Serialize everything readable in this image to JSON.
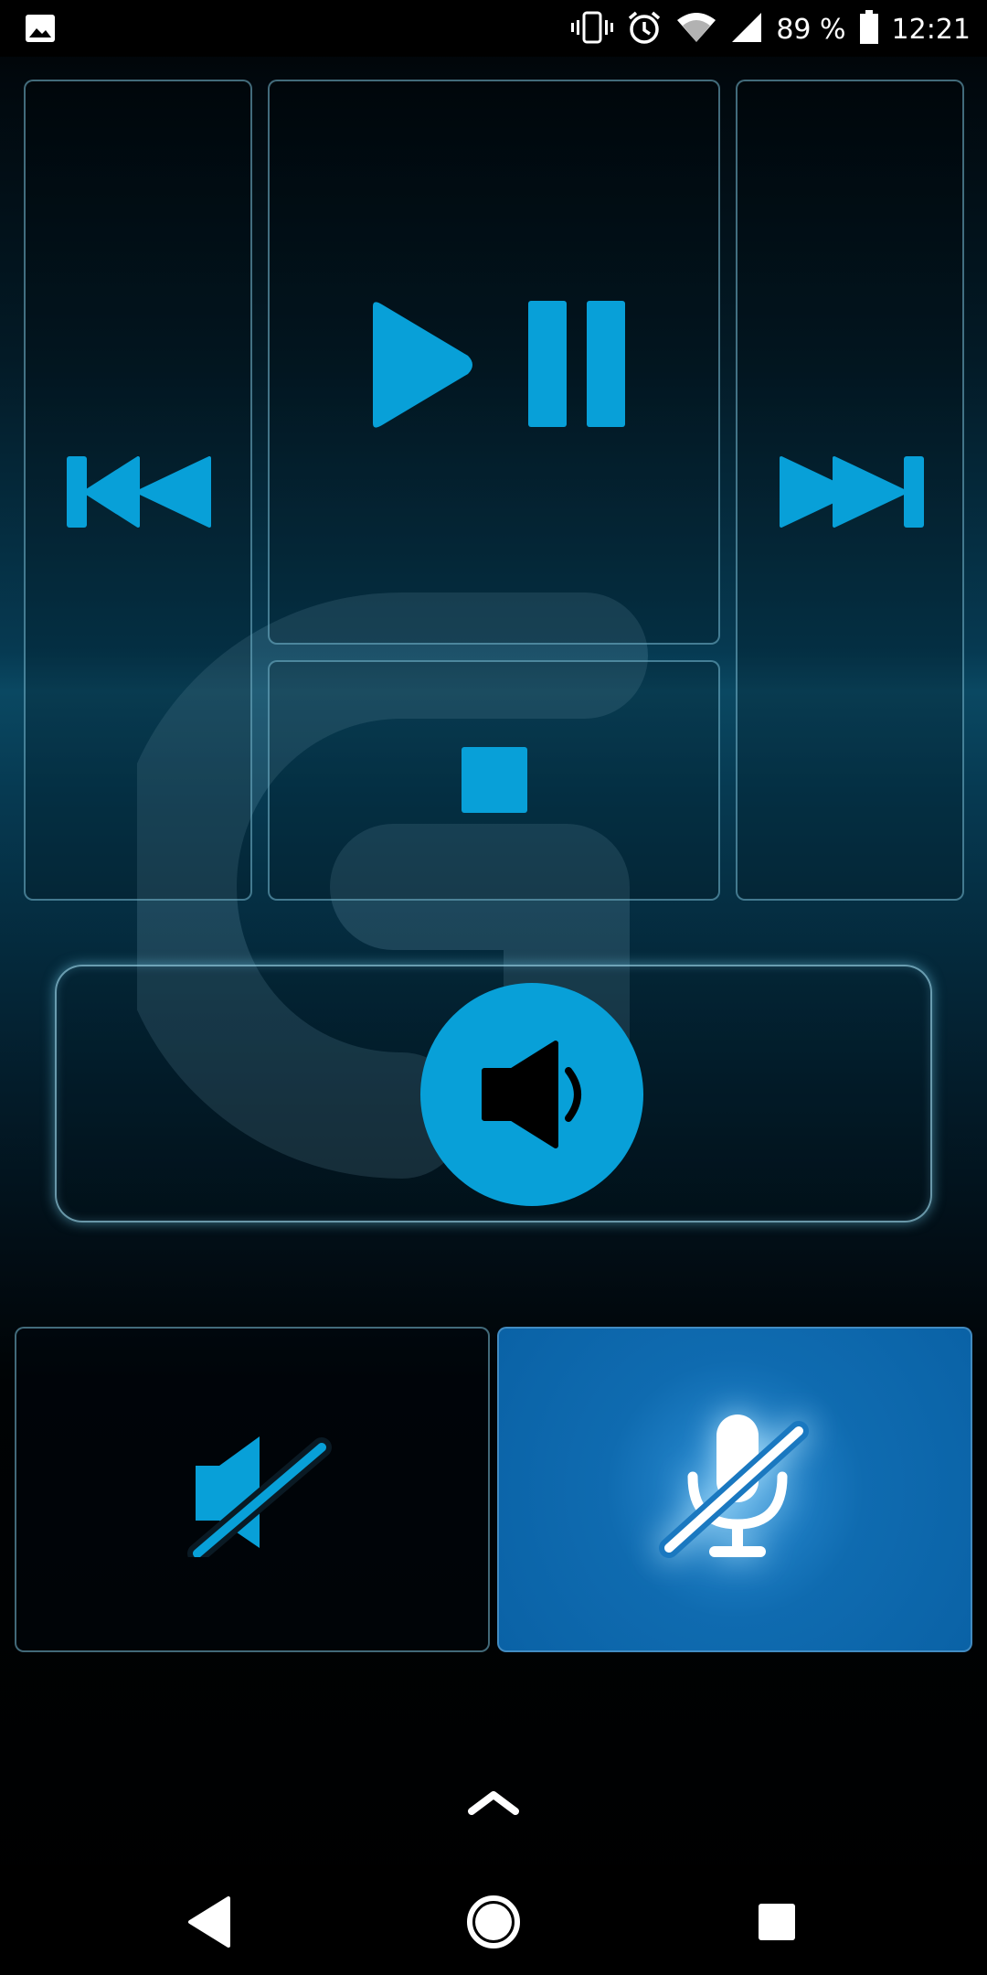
{
  "status_bar": {
    "left_icon": "image-notification-icon",
    "battery_percent": "89 %",
    "time": "12:21",
    "icons": [
      "vibrate-icon",
      "alarm-icon",
      "wifi-icon",
      "cell-signal-icon",
      "battery-icon"
    ]
  },
  "controls": {
    "previous": "skip-previous-icon",
    "play_pause": "play-pause-icon",
    "stop": "stop-icon",
    "next": "skip-next-icon",
    "volume": "volume-icon",
    "mute_speaker": "speaker-muted-icon",
    "mute_mic": "mic-muted-icon",
    "mic_mute_active": true
  },
  "colors": {
    "accent": "#08a0d8",
    "mic_active_bg": "#0a62a6",
    "background_top": "#000000",
    "background_mid": "#063a52"
  },
  "nav_bar": {
    "icons": [
      "back-icon",
      "home-icon",
      "recents-icon"
    ]
  }
}
